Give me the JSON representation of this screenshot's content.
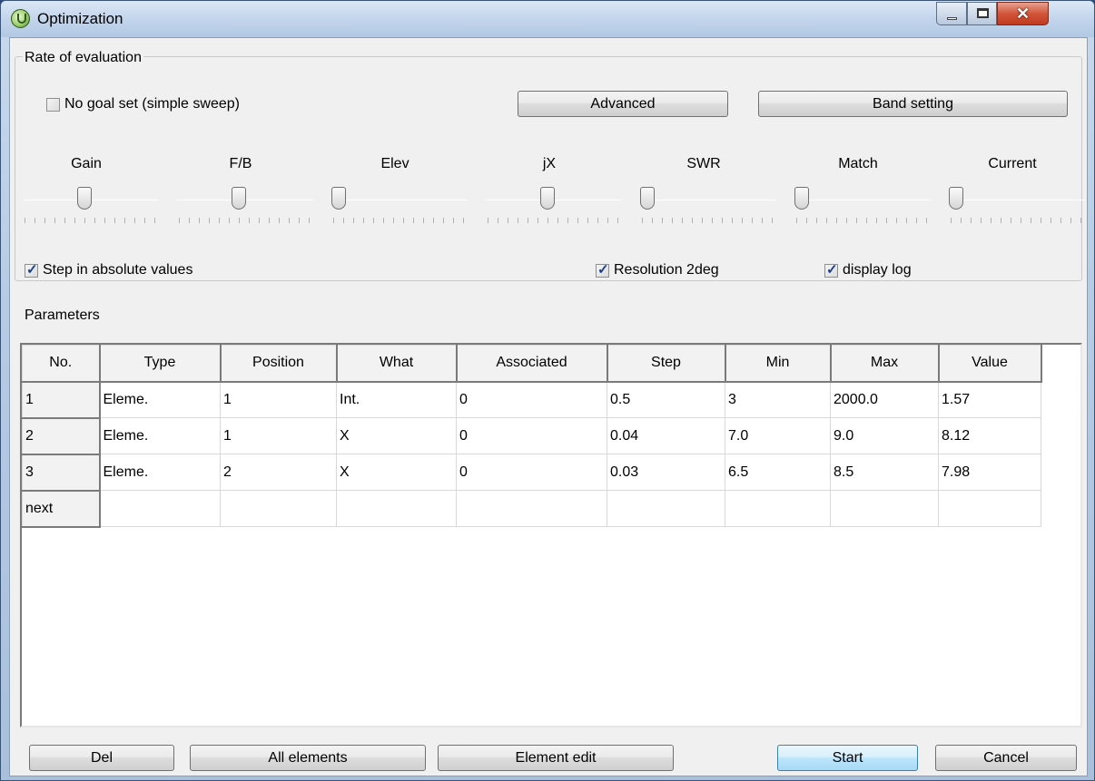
{
  "window": {
    "title": "Optimization",
    "controls": {
      "minimize": "minimize-icon",
      "maximize": "maximize-icon",
      "close": "close-icon"
    }
  },
  "rate_of_evaluation": {
    "legend": "Rate of evaluation",
    "no_goal_checkbox": {
      "label": "No goal set (simple sweep)",
      "checked": false
    },
    "advanced_button": "Advanced",
    "band_setting_button": "Band setting",
    "sliders": [
      {
        "label": "Gain",
        "level": 0.4
      },
      {
        "label": "F/B",
        "level": 0.4
      },
      {
        "label": "Elev",
        "level": 0.0
      },
      {
        "label": "jX",
        "level": 0.4
      },
      {
        "label": "SWR",
        "level": 0.0
      },
      {
        "label": "Match",
        "level": 0.0
      },
      {
        "label": "Current",
        "level": 0.0
      }
    ]
  },
  "options": {
    "step_absolute": {
      "label": "Step in absolute values",
      "checked": true
    },
    "resolution": {
      "label": "Resolution 2deg",
      "checked": true
    },
    "display_log": {
      "label": "display log",
      "checked": true
    }
  },
  "parameters": {
    "label": "Parameters",
    "columns": [
      "No.",
      "Type",
      "Position",
      "What",
      "Associated",
      "Step",
      "Min",
      "Max",
      "Value"
    ],
    "rows": [
      {
        "no": "1",
        "cells": [
          "Eleme.",
          "1",
          "Int.",
          "0",
          "0.5",
          "3",
          "2000.0",
          "1.57"
        ]
      },
      {
        "no": "2",
        "cells": [
          "Eleme.",
          "1",
          "X",
          "0",
          "0.04",
          "7.0",
          "9.0",
          "8.12"
        ]
      },
      {
        "no": "3",
        "cells": [
          "Eleme.",
          "2",
          "X",
          "0",
          "0.03",
          "6.5",
          "8.5",
          "7.98"
        ]
      },
      {
        "no": "next",
        "cells": [
          "",
          "",
          "",
          "",
          "",
          "",
          "",
          ""
        ]
      }
    ]
  },
  "footer": {
    "del_button": "Del",
    "all_elements_button": "All elements",
    "element_edit_button": "Element edit",
    "start_button": "Start",
    "cancel_button": "Cancel"
  }
}
